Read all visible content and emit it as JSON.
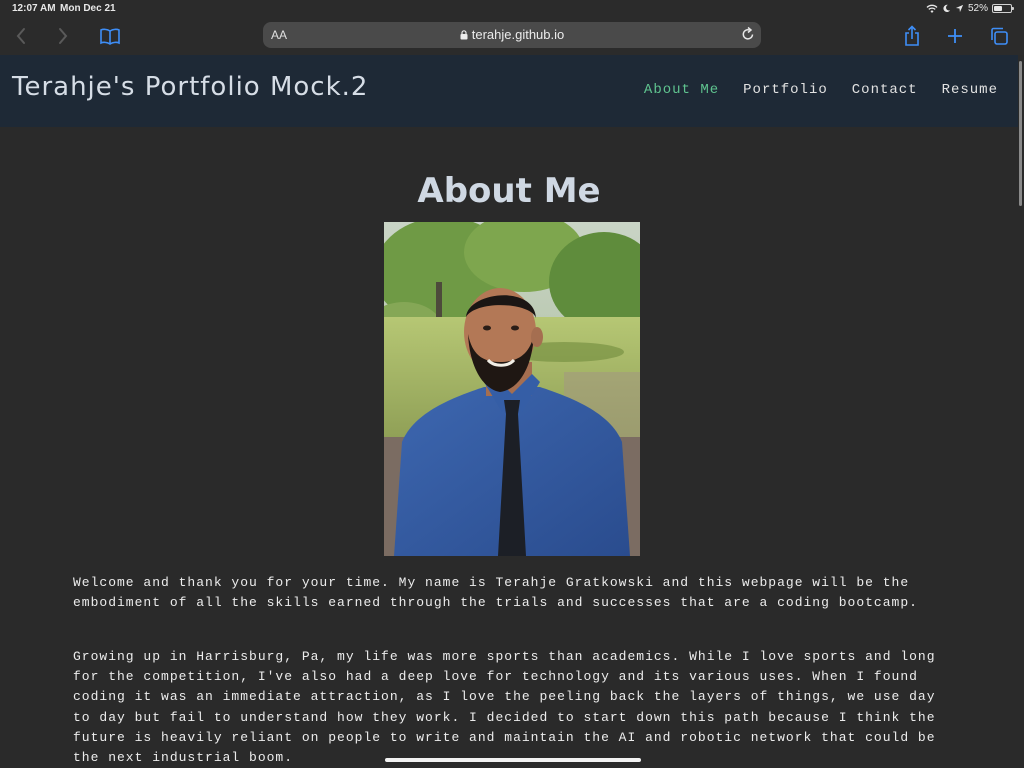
{
  "status_bar": {
    "time": "12:07 AM",
    "date": "Mon Dec 21",
    "battery_percent": "52%",
    "battery_level": 0.52
  },
  "browser": {
    "text_size_label": "AA",
    "url": "terahje.github.io",
    "icons": [
      "back-icon",
      "forward-icon",
      "bookmarks-icon",
      "lock-icon",
      "reload-icon",
      "share-icon",
      "new-tab-icon",
      "tabs-icon"
    ]
  },
  "site": {
    "brand": "Terahje's Portfolio Mock.2",
    "nav": [
      {
        "label": "About Me",
        "active": true
      },
      {
        "label": "Portfolio",
        "active": false
      },
      {
        "label": "Contact",
        "active": false
      },
      {
        "label": "Resume",
        "active": false
      }
    ],
    "accent_color": "#5fc38f",
    "nav_background": "#1e2936"
  },
  "main": {
    "heading": "About Me",
    "paragraphs": [
      "Welcome and thank you for your time. My name is Terahje Gratkowski and this webpage will be the embodiment of all the skills earned through the trials and successes that are a coding bootcamp.",
      "Growing up in Harrisburg, Pa, my life was more sports than academics. While I love sports and long for the competition, I've also had a deep love for technology and its various uses. When I found coding it was an immediate attraction, as I love the peeling back the layers of things, we use day to day but fail to understand how they work. I decided to start down this path because I think the future is heavily reliant on people to write and maintain the AI and robotic network that could be the next industrial boom."
    ]
  }
}
